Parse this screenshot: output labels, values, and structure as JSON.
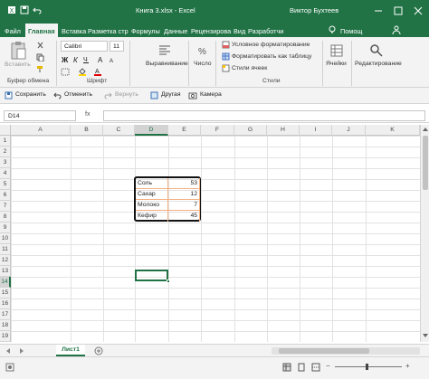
{
  "window": {
    "title": "Книга 3.xlsx  -  Excel",
    "user": "Виктор Бухтеев"
  },
  "tabs": [
    {
      "label": "Файл"
    },
    {
      "label": "Главная"
    },
    {
      "label": "Вставка"
    },
    {
      "label": "Разметка стр"
    },
    {
      "label": "Формулы"
    },
    {
      "label": "Данные"
    },
    {
      "label": "Рецензирова"
    },
    {
      "label": "Вид"
    },
    {
      "label": "Разработчи"
    },
    {
      "label": "Помощ"
    }
  ],
  "ribbon": {
    "paste_label": "Вставить",
    "font_name": "Calibri",
    "font_size": "11",
    "groups": {
      "clipboard": "Буфер обмена",
      "font": "Шрифт",
      "styles": "Стили"
    },
    "alignment_label": "Выравнивание",
    "number_label": "Число",
    "cond_format": "Условное форматирование",
    "format_as_table": "Форматировать как таблицу",
    "cell_styles": "Стили ячеек",
    "cells_label": "Ячейки",
    "editing_label": "Редактирование"
  },
  "quick_toolbar": {
    "save": "Сохранить",
    "undo": "Отменить",
    "redo": "Вернуть",
    "other": "Другая",
    "camera": "Камера"
  },
  "formula_bar": {
    "name_box": "D14",
    "fx": "fx",
    "value": ""
  },
  "columns": [
    "A",
    "B",
    "C",
    "D",
    "E",
    "F",
    "G",
    "H",
    "I",
    "J",
    "K"
  ],
  "rows": [
    "1",
    "2",
    "3",
    "4",
    "5",
    "6",
    "7",
    "8",
    "9",
    "10",
    "11",
    "12",
    "13",
    "14",
    "15",
    "16",
    "17",
    "18",
    "19"
  ],
  "table": [
    {
      "name": "Соль",
      "value": "53"
    },
    {
      "name": "Сахар",
      "value": "12"
    },
    {
      "name": "Молоко",
      "value": "7"
    },
    {
      "name": "Кефир",
      "value": "45"
    }
  ],
  "sheet_tab": "Лист1",
  "colors": {
    "accent": "#217346",
    "table_border": "#f4b183"
  }
}
